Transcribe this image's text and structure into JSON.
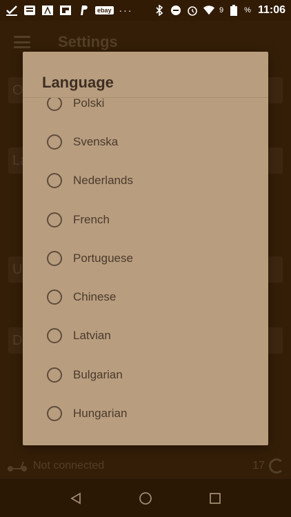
{
  "status_bar": {
    "ebay_label": "ebay",
    "overflow_dots": "···",
    "battery_text": "9",
    "battery_percent": "%",
    "time": "11:06"
  },
  "app_bar": {
    "title": "Settings"
  },
  "background": {
    "cards": [
      {
        "label": "O"
      },
      {
        "label": "La"
      },
      {
        "label": "U"
      },
      {
        "label": "De"
      }
    ],
    "status_text": "Not connected",
    "count": "17"
  },
  "dialog": {
    "title": "Language",
    "options": [
      {
        "label": "Polski"
      },
      {
        "label": "Svenska"
      },
      {
        "label": "Nederlands"
      },
      {
        "label": "French"
      },
      {
        "label": "Portuguese"
      },
      {
        "label": "Chinese"
      },
      {
        "label": "Latvian"
      },
      {
        "label": "Bulgarian"
      },
      {
        "label": "Hungarian"
      }
    ]
  },
  "icons": {
    "status": [
      "checkmark-icon",
      "news-icon",
      "jordan-icon",
      "flipboard-icon",
      "paypal-icon",
      "ebay-icon",
      "bluetooth-icon",
      "do-not-disturb-icon",
      "alarm-icon",
      "wifi-icon",
      "battery-icon"
    ],
    "nav": [
      "back-icon",
      "home-icon",
      "recents-icon"
    ]
  }
}
